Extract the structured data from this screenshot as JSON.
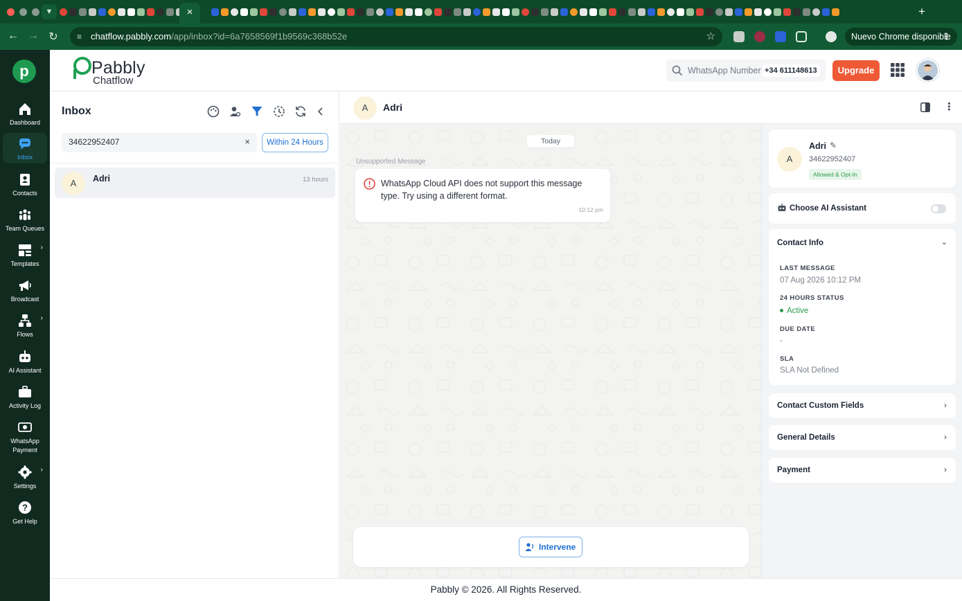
{
  "browser": {
    "url_host": "chatflow.pabbly.com",
    "url_path": "/app/inbox?id=6a7658569f1b9569c368b52e",
    "update_label": "Nuevo Chrome disponible",
    "colors": {
      "frame": "#0d4a2a",
      "toolbar": "#125c35"
    }
  },
  "brand": {
    "name": "Pabbly",
    "product": "Chatflow",
    "mark_letter": "p",
    "colors": {
      "primary": "#1ea152"
    }
  },
  "sidebar": {
    "items": [
      {
        "label": "Dashboard",
        "icon": "home-icon"
      },
      {
        "label": "Inbox",
        "icon": "chat-icon",
        "active": true
      },
      {
        "label": "Contacts",
        "icon": "contact-card-icon"
      },
      {
        "label": "Team Queues",
        "icon": "team-icon"
      },
      {
        "label": "Templates",
        "icon": "template-icon",
        "has_submenu": true
      },
      {
        "label": "Broadcast",
        "icon": "megaphone-icon"
      },
      {
        "label": "Flows",
        "icon": "flows-icon",
        "has_submenu": true
      },
      {
        "label": "AI Assistant",
        "icon": "robot-icon"
      },
      {
        "label": "Activity Log",
        "icon": "briefcase-icon"
      },
      {
        "label": "WhatsApp Payment",
        "icon": "payment-icon"
      },
      {
        "label": "Settings",
        "icon": "gear-icon",
        "has_submenu": true
      },
      {
        "label": "Get Help",
        "icon": "help-icon"
      }
    ]
  },
  "header": {
    "search_label": "WhatsApp Number:",
    "whatsapp_number": "+34 611148613",
    "upgrade_label": "Upgrade",
    "colors": {
      "upgrade": "#ee5a36"
    }
  },
  "inbox": {
    "title": "Inbox",
    "search_value": "34622952407",
    "filter_label": "Within 24 Hours",
    "conversations": [
      {
        "initial": "A",
        "name": "Adri",
        "time": "13 hours"
      }
    ]
  },
  "chat": {
    "contact_initial": "A",
    "contact_name": "Adri",
    "day_label": "Today",
    "unsupported_label": "Unsupported Message",
    "message_text": "WhatsApp Cloud API does not support this message type. Try using a different format.",
    "message_time": "10:12 pm",
    "intervene_label": "Intervene"
  },
  "details": {
    "initial": "A",
    "name": "Adri",
    "phone": "34622952407",
    "badge": "Allowed & Opt-In",
    "ai_label": "Choose AI Assistant",
    "ai_enabled": false,
    "contact_info_title": "Contact Info",
    "fields": [
      {
        "key": "LAST MESSAGE",
        "value": "07 Aug 2026 10:12 PM"
      },
      {
        "key": "24 HOURS STATUS",
        "value": "Active"
      },
      {
        "key": "DUE DATE",
        "value": "-"
      },
      {
        "key": "SLA",
        "value": "SLA Not Defined"
      }
    ],
    "sections": [
      "Contact Custom Fields",
      "General Details",
      "Payment"
    ]
  },
  "footer": {
    "text": "Pabbly © 2026. All Rights Reserved."
  }
}
